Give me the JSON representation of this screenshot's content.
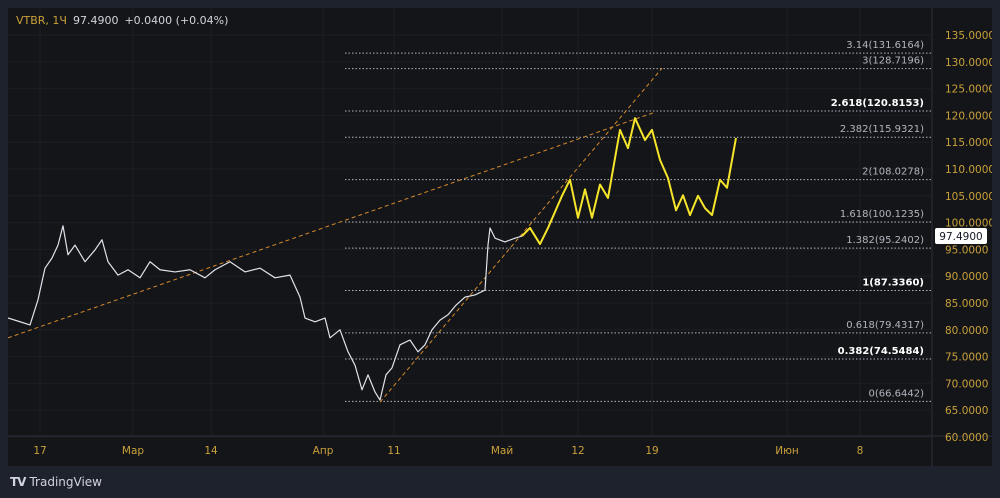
{
  "legend": {
    "symbol": "VTBR, 1Ч",
    "price": "97.4900",
    "change": "+0.0400 (+0.04%)"
  },
  "brand": {
    "name": "TradingView"
  },
  "colors": {
    "axis_text": "#c9a13a",
    "price_line": "#e0e3eb",
    "projection": "#f5e52a",
    "trendline": "#d4892a",
    "background": "#141519"
  },
  "chart_data": {
    "type": "line",
    "ylim": [
      60,
      135
    ],
    "y_ticks": [
      "135.0000",
      "130.0000",
      "125.0000",
      "120.0000",
      "115.0000",
      "110.0000",
      "105.0000",
      "100.0000",
      "95.0000",
      "90.0000",
      "85.0000",
      "80.0000",
      "75.0000",
      "70.0000",
      "65.0000",
      "60.0000"
    ],
    "x_ticks": [
      {
        "label": "17",
        "bar": 32
      },
      {
        "label": "Мар",
        "bar": 125
      },
      {
        "label": "14",
        "bar": 203
      },
      {
        "label": "Апр",
        "bar": 315
      },
      {
        "label": "11",
        "bar": 386
      },
      {
        "label": "Май",
        "bar": 494
      },
      {
        "label": "12",
        "bar": 570
      },
      {
        "label": "19",
        "bar": 644
      },
      {
        "label": "Июн",
        "bar": 779
      },
      {
        "label": "8",
        "bar": 852
      }
    ],
    "current_price": "97.4900",
    "series": [
      {
        "name": "VTBR",
        "x": [
          0,
          12,
          22,
          30,
          37,
          44,
          50,
          55,
          60,
          67,
          77,
          87,
          94,
          100,
          110,
          120,
          132,
          142,
          152,
          167,
          182,
          197,
          207,
          222,
          237,
          252,
          267,
          282,
          292,
          297,
          307,
          317,
          322,
          332,
          340,
          347,
          354,
          360,
          367,
          372,
          378,
          384,
          392,
          402,
          410,
          417,
          424,
          432,
          440,
          448,
          457,
          467,
          477,
          480,
          482,
          487,
          497,
          507,
          514
        ],
        "y": [
          82.2,
          81.5,
          80.9,
          85.6,
          91.5,
          93.4,
          95.8,
          99.4,
          94,
          95.8,
          92.7,
          94.9,
          96.8,
          92.7,
          90.2,
          91.2,
          89.7,
          92.7,
          91.2,
          90.8,
          91.2,
          89.7,
          91.2,
          92.7,
          90.8,
          91.5,
          89.7,
          90.2,
          86.1,
          82.2,
          81.5,
          82.2,
          78.5,
          80,
          75.9,
          73.4,
          68.8,
          71.6,
          68.4,
          66.9,
          71.6,
          72.9,
          77.2,
          78.1,
          75.9,
          77.2,
          80,
          81.8,
          82.8,
          84.6,
          86.1,
          86.5,
          87.4,
          95.8,
          99,
          97.1,
          96.4,
          97.1,
          97.49
        ]
      },
      {
        "name": "Projection",
        "x": [
          514,
          522,
          532,
          540,
          547,
          554,
          562,
          570,
          577,
          584,
          592,
          600,
          612,
          620,
          627,
          637,
          644,
          652,
          660,
          668,
          675,
          682,
          690,
          697,
          704,
          712,
          719,
          728
        ],
        "y": [
          97.49,
          99,
          96,
          99,
          102,
          105,
          108,
          100.9,
          106.2,
          100.9,
          107.1,
          104.6,
          117.3,
          113.9,
          119.5,
          115.4,
          117.3,
          111.7,
          108.3,
          102.3,
          105.1,
          101.4,
          105,
          102.7,
          101.4,
          108,
          106.5,
          115.8
        ]
      }
    ],
    "trendlines": [
      {
        "x": [
          0,
          647
        ],
        "y": [
          78.5,
          120.6
        ]
      },
      {
        "x": [
          372,
          654
        ],
        "y": [
          66.5,
          128.8
        ]
      }
    ],
    "fib_levels": [
      {
        "ratio": "3.14",
        "value": "131.6164",
        "v": 131.6164,
        "bold": false
      },
      {
        "ratio": "3",
        "value": "128.7196",
        "v": 128.7196,
        "bold": false
      },
      {
        "ratio": "2.618",
        "value": "120.8153",
        "v": 120.8153,
        "bold": true
      },
      {
        "ratio": "2.382",
        "value": "115.9321",
        "v": 115.9321,
        "bold": false
      },
      {
        "ratio": "2",
        "value": "108.0278",
        "v": 108.0278,
        "bold": false
      },
      {
        "ratio": "1.618",
        "value": "100.1235",
        "v": 100.1235,
        "bold": false
      },
      {
        "ratio": "1.382",
        "value": "95.2402",
        "v": 95.2402,
        "bold": false
      },
      {
        "ratio": "1",
        "value": "87.3360",
        "v": 87.336,
        "bold": true
      },
      {
        "ratio": "0.618",
        "value": "79.4317",
        "v": 79.4317,
        "bold": false
      },
      {
        "ratio": "0.382",
        "value": "74.5484",
        "v": 74.5484,
        "bold": true
      },
      {
        "ratio": "0",
        "value": "66.6442",
        "v": 66.6442,
        "bold": false
      }
    ]
  }
}
